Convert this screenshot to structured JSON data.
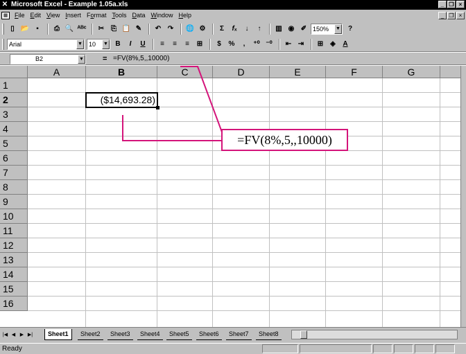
{
  "window": {
    "title": "Microsoft Excel - Example 1.05a.xls"
  },
  "menu": [
    {
      "label": "File",
      "accel": "F"
    },
    {
      "label": "Edit",
      "accel": "E"
    },
    {
      "label": "View",
      "accel": "V"
    },
    {
      "label": "Insert",
      "accel": "I"
    },
    {
      "label": "Format",
      "accel": "o"
    },
    {
      "label": "Tools",
      "accel": "T"
    },
    {
      "label": "Data",
      "accel": "D"
    },
    {
      "label": "Window",
      "accel": "W"
    },
    {
      "label": "Help",
      "accel": "H"
    }
  ],
  "toolbar": {
    "zoom": "150%",
    "font_name": "Arial",
    "font_size": "10"
  },
  "formula_bar": {
    "name_box": "B2",
    "formula": "=FV(8%,5,,10000)"
  },
  "sheet": {
    "columns": [
      "A",
      "B",
      "C",
      "D",
      "E",
      "F",
      "G"
    ],
    "rows": [
      "1",
      "2",
      "3",
      "4",
      "5",
      "6",
      "7",
      "8",
      "9",
      "10",
      "11",
      "12",
      "13",
      "14",
      "15",
      "16"
    ],
    "active_cell_value": "($14,693.28)",
    "annotation": "=FV(8%,5,,10000)",
    "annotation_color": "#d4147a"
  },
  "tabs": [
    "Sheet1",
    "Sheet2",
    "Sheet3",
    "Sheet4",
    "Sheet5",
    "Sheet6",
    "Sheet7",
    "Sheet8"
  ],
  "status": "Ready"
}
